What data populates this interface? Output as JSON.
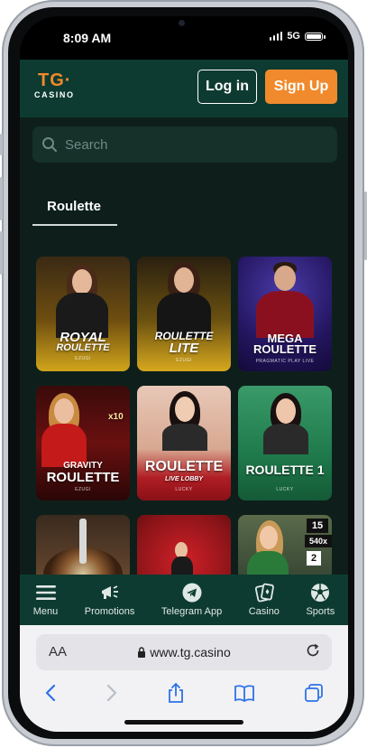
{
  "status_bar": {
    "time": "8:09 AM",
    "network": "5G"
  },
  "header": {
    "logo_tg": "TG·",
    "logo_casino": "CASINO",
    "login_label": "Log in",
    "signup_label": "Sign Up"
  },
  "search": {
    "placeholder": "Search"
  },
  "tabs": {
    "active": "Roulette"
  },
  "games": [
    {
      "name": "ROYAL ROULETTE",
      "line1": "ROYAL",
      "line2": "ROULETTE",
      "provider": "EZUGI",
      "bg": "#b88a10"
    },
    {
      "name": "ROULETTE LITE",
      "line1": "ROULETTE",
      "line2": "LITE",
      "provider": "EZUGI",
      "bg": "#a07a10"
    },
    {
      "name": "MEGA ROULETTE",
      "line1": "MEGA",
      "line2": "ROULETTE",
      "provider": "PRAGMATIC PLAY LIVE",
      "bg": "#2a1a78"
    },
    {
      "name": "GRAVITY ROULETTE",
      "line1": "GRAVITY",
      "line2": "ROULETTE",
      "provider": "EZUGI",
      "bg": "#7a1412"
    },
    {
      "name": "ROULETTE LIVE LOBBY",
      "line1": "ROULETTE",
      "line2": "LIVE LOBBY",
      "provider": "LUCKY",
      "bg": "#b2262c"
    },
    {
      "name": "ROULETTE 1",
      "line1": "ROULETTE 1",
      "line2": "",
      "provider": "LUCKY",
      "bg": "#1f7a4b"
    },
    {
      "name": "",
      "line1": "",
      "line2": "",
      "provider": "",
      "bg": "#5a3a28"
    },
    {
      "name": "",
      "line1": "",
      "line2": "",
      "provider": "",
      "bg": "#8a1418"
    },
    {
      "name": "",
      "line1": "",
      "line2": "",
      "provider": "",
      "bg": "#3a4a36"
    }
  ],
  "card_extras": {
    "multiplier": "x10",
    "number": "15",
    "multiplier2": "540x",
    "number2": "2"
  },
  "bottom_nav": [
    {
      "label": "Menu",
      "icon": "menu-icon"
    },
    {
      "label": "Promotions",
      "icon": "megaphone-icon"
    },
    {
      "label": "Telegram App",
      "icon": "telegram-icon"
    },
    {
      "label": "Casino",
      "icon": "cards-icon"
    },
    {
      "label": "Sports",
      "icon": "soccer-ball-icon"
    }
  ],
  "browser": {
    "aa": "AA",
    "url": "www.tg.casino"
  },
  "colors": {
    "brand_orange": "#f08a2c",
    "header_green": "#0e3b31",
    "page_bg": "#0e1f1b"
  }
}
